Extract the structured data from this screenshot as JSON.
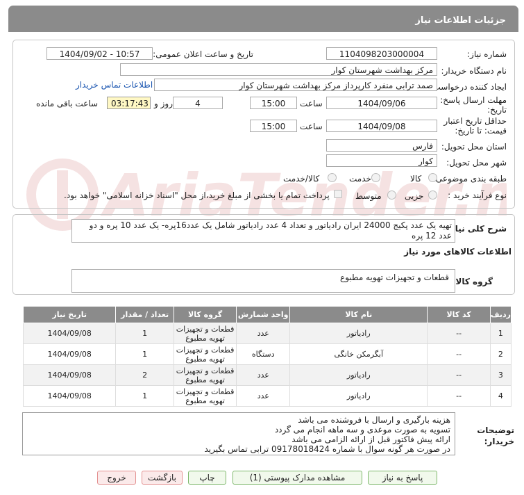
{
  "panel": {
    "title": "جزئیات اطلاعات نیاز"
  },
  "form": {
    "need_number_label": "شماره نیاز:",
    "need_number": "1104098203000004",
    "announce_label": "تاریخ و ساعت اعلان عمومی:",
    "announce_value": "1404/09/02 - 10:57",
    "buyer_label": "نام دستگاه خریدار:",
    "buyer_value": "مرکز بهداشت شهرستان کوار",
    "creator_label": "ایجاد کننده درخواست:",
    "creator_value": "صمد ترابی منفرد کارپرداز مرکز بهداشت شهرستان کوار",
    "contact_link": "اطلاعات تماس خریدار",
    "deadline_label_1": "مهلت ارسال پاسخ: تا",
    "deadline_label_2": "تاریخ:",
    "deadline_date": "1404/09/06",
    "time_label": "ساعت",
    "deadline_time": "15:00",
    "days_value": "4",
    "days_label": "روز و",
    "remaining_time": "03:17:43",
    "remaining_label": "ساعت باقی مانده",
    "validity_label_1": "حداقل تاریخ اعتبار",
    "validity_label_2": "قیمت: تا تاریخ:",
    "validity_date": "1404/09/08",
    "validity_time": "15:00",
    "province_label": "استان محل تحویل:",
    "province_value": "فارس",
    "city_label": "شهر محل تحویل:",
    "city_value": "کوار",
    "category_label": "طبقه بندی موضوعی:",
    "cat_goods": "کالا",
    "cat_service": "خدمت",
    "cat_goods_service": "کالا/خدمت",
    "process_label": "نوع فرآیند خرید :",
    "proc_partial": "جزیی",
    "proc_medium": "متوسط",
    "payment_note": "پرداخت تمام یا بخشی از مبلغ خرید،از محل \"اسناد خزانه اسلامی\" خواهد بود."
  },
  "description": {
    "label": "شرح کلی نیاز:",
    "text": "تهیه یک عدد پکیج 24000 ایران رادیاتور و تعداد 4 عدد رادیاتور شامل یک عدد16پره- یک عدد 10 پره و دو عدد 12 پره"
  },
  "goods_info": {
    "title": "اطلاعات کالاهای مورد نیاز",
    "group_label": "گروه کالا:",
    "group_value": "قطعات و تجهیزات تهویه مطبوع"
  },
  "table": {
    "headers": [
      "ردیف",
      "کد کالا",
      "نام کالا",
      "واحد شمارش",
      "گروه کالا",
      "تعداد / مقدار",
      "تاریخ نیاز"
    ],
    "rows": [
      {
        "idx": "1",
        "code": "--",
        "name": "رادیاتور",
        "unit": "عدد",
        "group_1": "قطعات و تجهیزات",
        "group_2": "تهویه مطبوع",
        "qty": "1",
        "date": "1404/09/08"
      },
      {
        "idx": "2",
        "code": "--",
        "name": "آبگرمکن خانگی",
        "unit": "دستگاه",
        "group_1": "قطعات و تجهیزات",
        "group_2": "تهویه مطبوع",
        "qty": "1",
        "date": "1404/09/08"
      },
      {
        "idx": "3",
        "code": "--",
        "name": "رادیاتور",
        "unit": "عدد",
        "group_1": "قطعات و تجهیزات",
        "group_2": "تهویه مطبوع",
        "qty": "2",
        "date": "1404/09/08"
      },
      {
        "idx": "4",
        "code": "--",
        "name": "رادیاتور",
        "unit": "عدد",
        "group_1": "قطعات و تجهیزات",
        "group_2": "تهویه مطبوع",
        "qty": "1",
        "date": "1404/09/08"
      }
    ]
  },
  "notes": {
    "label_1": "توضیحات",
    "label_2": "خریدار:",
    "lines": [
      "هزینه بارگیری و ارسال با فروشنده می باشد",
      "تسویه به صورت موعدی و سه ماهه انجام می گردد",
      "ارائه پیش فاکتور قبل از ارائه الزامی می باشد",
      "در صورت هر گونه سوال با شماره 09178018424 ترابی تماس بگیرید"
    ]
  },
  "buttons": {
    "reply": "پاسخ به نیاز",
    "view_docs": "مشاهده مدارک پیوستی (1)",
    "print": "چاپ",
    "back": "بازگشت",
    "exit": "خروج"
  },
  "watermark": {
    "text": "AriaTender.neT"
  }
}
